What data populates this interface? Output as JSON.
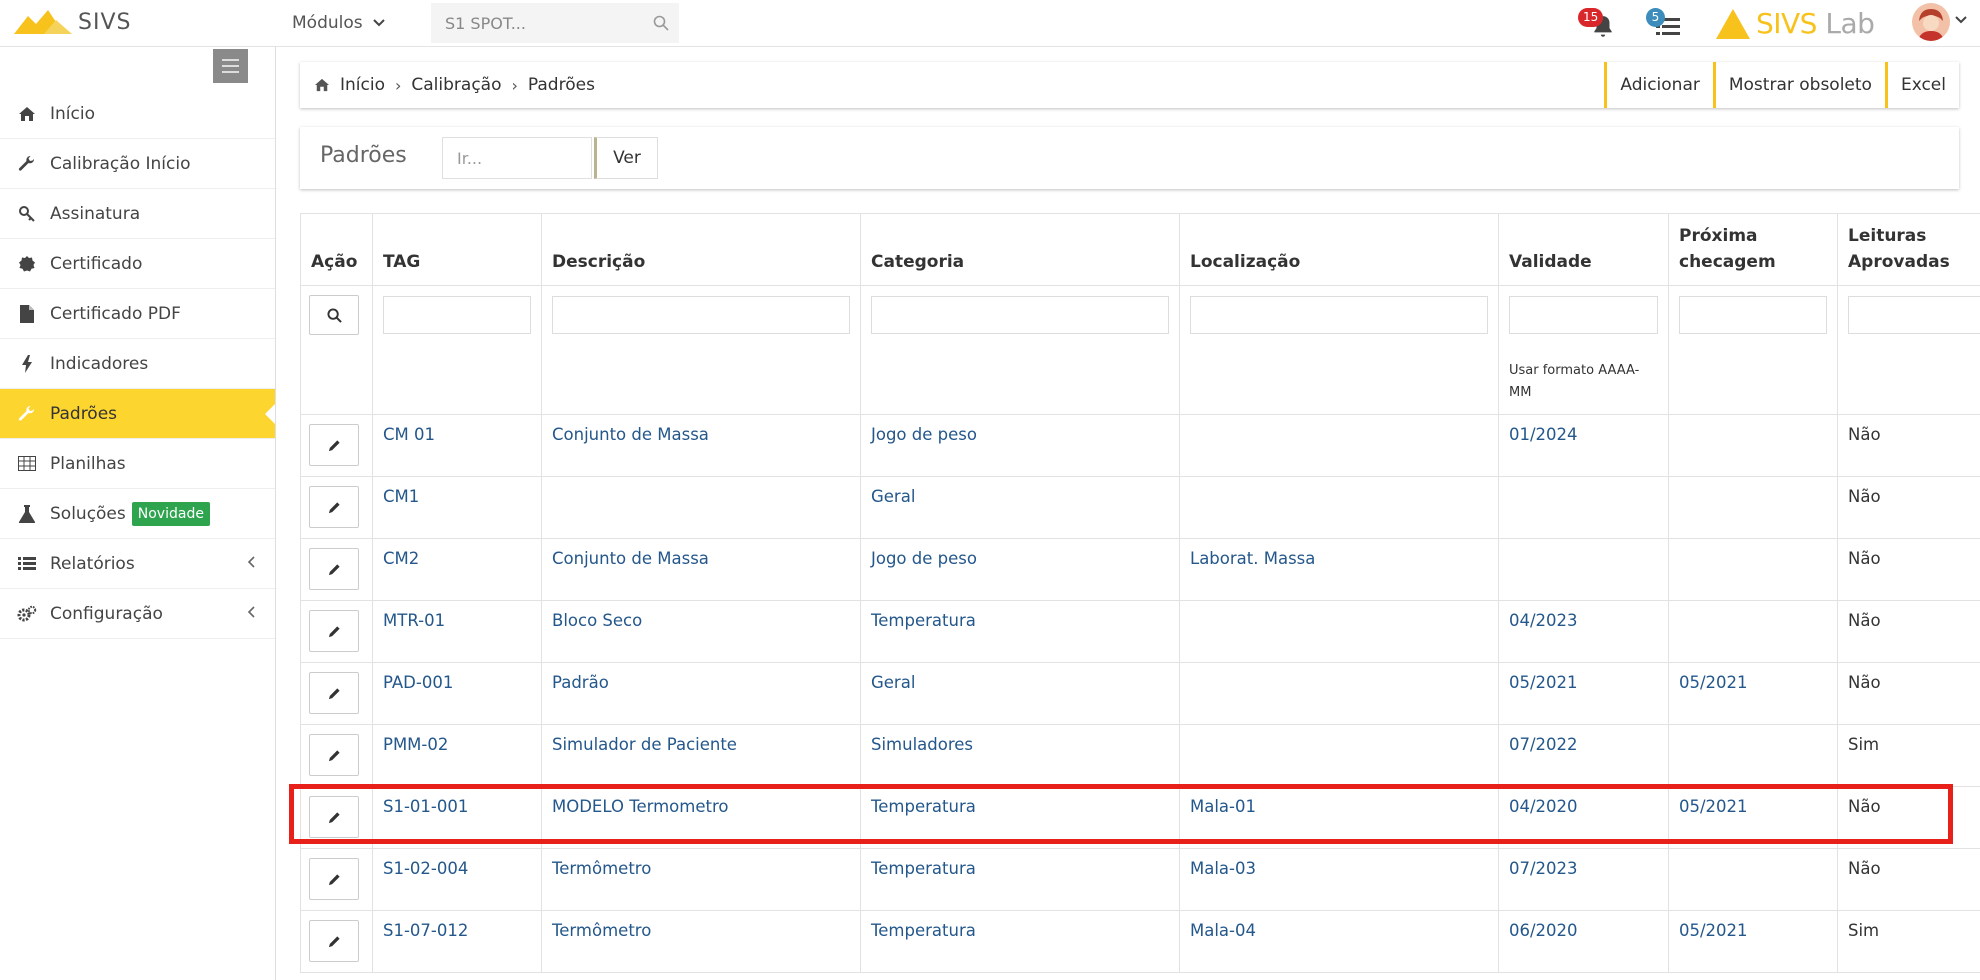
{
  "app": {
    "name": "SIVS",
    "modules_label": "Módulos",
    "search_placeholder": "S1 SPOT...",
    "notifications_count": "15",
    "tasks_count": "5",
    "brand_right_1": "SIVS",
    "brand_right_2": "Lab",
    "accent_color": "#fdd52f"
  },
  "sidebar": {
    "items": [
      {
        "label": "Início",
        "icon": "home-icon"
      },
      {
        "label": "Calibração Início",
        "icon": "wrench-icon"
      },
      {
        "label": "Assinatura",
        "icon": "key-icon"
      },
      {
        "label": "Certificado",
        "icon": "certificate-icon"
      },
      {
        "label": "Certificado PDF",
        "icon": "file-icon"
      },
      {
        "label": "Indicadores",
        "icon": "bolt-icon"
      },
      {
        "label": "Padrões",
        "icon": "wrench-icon",
        "active": true
      },
      {
        "label": "Planilhas",
        "icon": "table-icon"
      },
      {
        "label": "Soluções",
        "icon": "flask-icon",
        "badge": "Novidade"
      },
      {
        "label": "Relatórios",
        "icon": "list-icon"
      },
      {
        "label": "Configuração",
        "icon": "cogs-icon"
      }
    ]
  },
  "breadcrumb": {
    "items": [
      "Início",
      "Calibração",
      "Padrões"
    ],
    "buttons": [
      "Adicionar",
      "Mostrar obsoleto",
      "Excel"
    ]
  },
  "title": {
    "text": "Padrões",
    "go_placeholder": "Ir...",
    "ver_label": "Ver"
  },
  "table": {
    "headers": [
      "Ação",
      "TAG",
      "Descrição",
      "Categoria",
      "Localização",
      "Validade",
      "Próxima checagem",
      "Leituras Aprovadas"
    ],
    "validade_hint": "Usar formato AAAA-MM",
    "rows": [
      {
        "tag": "CM 01",
        "descricao": "Conjunto de Massa",
        "categoria": "Jogo de peso",
        "localizacao": "",
        "validade": "01/2024",
        "proxima": "",
        "leituras": "Não"
      },
      {
        "tag": "CM1",
        "descricao": "",
        "categoria": "Geral",
        "localizacao": "",
        "validade": "",
        "proxima": "",
        "leituras": "Não"
      },
      {
        "tag": "CM2",
        "descricao": "Conjunto de Massa",
        "categoria": "Jogo de peso",
        "localizacao": "Laborat. Massa",
        "validade": "",
        "proxima": "",
        "leituras": "Não"
      },
      {
        "tag": "MTR-01",
        "descricao": "Bloco Seco",
        "categoria": "Temperatura",
        "localizacao": "",
        "validade": "04/2023",
        "proxima": "",
        "leituras": "Não"
      },
      {
        "tag": "PAD-001",
        "descricao": "Padrão",
        "categoria": "Geral",
        "localizacao": "",
        "validade": "05/2021",
        "proxima": "05/2021",
        "leituras": "Não"
      },
      {
        "tag": "PMM-02",
        "descricao": "Simulador de Paciente",
        "categoria": "Simuladores",
        "localizacao": "",
        "validade": "07/2022",
        "proxima": "",
        "leituras": "Sim"
      },
      {
        "tag": "S1-01-001",
        "descricao": "MODELO Termometro",
        "categoria": "Temperatura",
        "localizacao": "Mala-01",
        "validade": "04/2020",
        "proxima": "05/2021",
        "leituras": "Não"
      },
      {
        "tag": "S1-02-004",
        "descricao": "Termômetro",
        "categoria": "Temperatura",
        "localizacao": "Mala-03",
        "validade": "07/2023",
        "proxima": "",
        "leituras": "Não"
      },
      {
        "tag": "S1-07-012",
        "descricao": "Termômetro",
        "categoria": "Temperatura",
        "localizacao": "Mala-04",
        "validade": "06/2020",
        "proxima": "05/2021",
        "leituras": "Sim"
      }
    ]
  }
}
